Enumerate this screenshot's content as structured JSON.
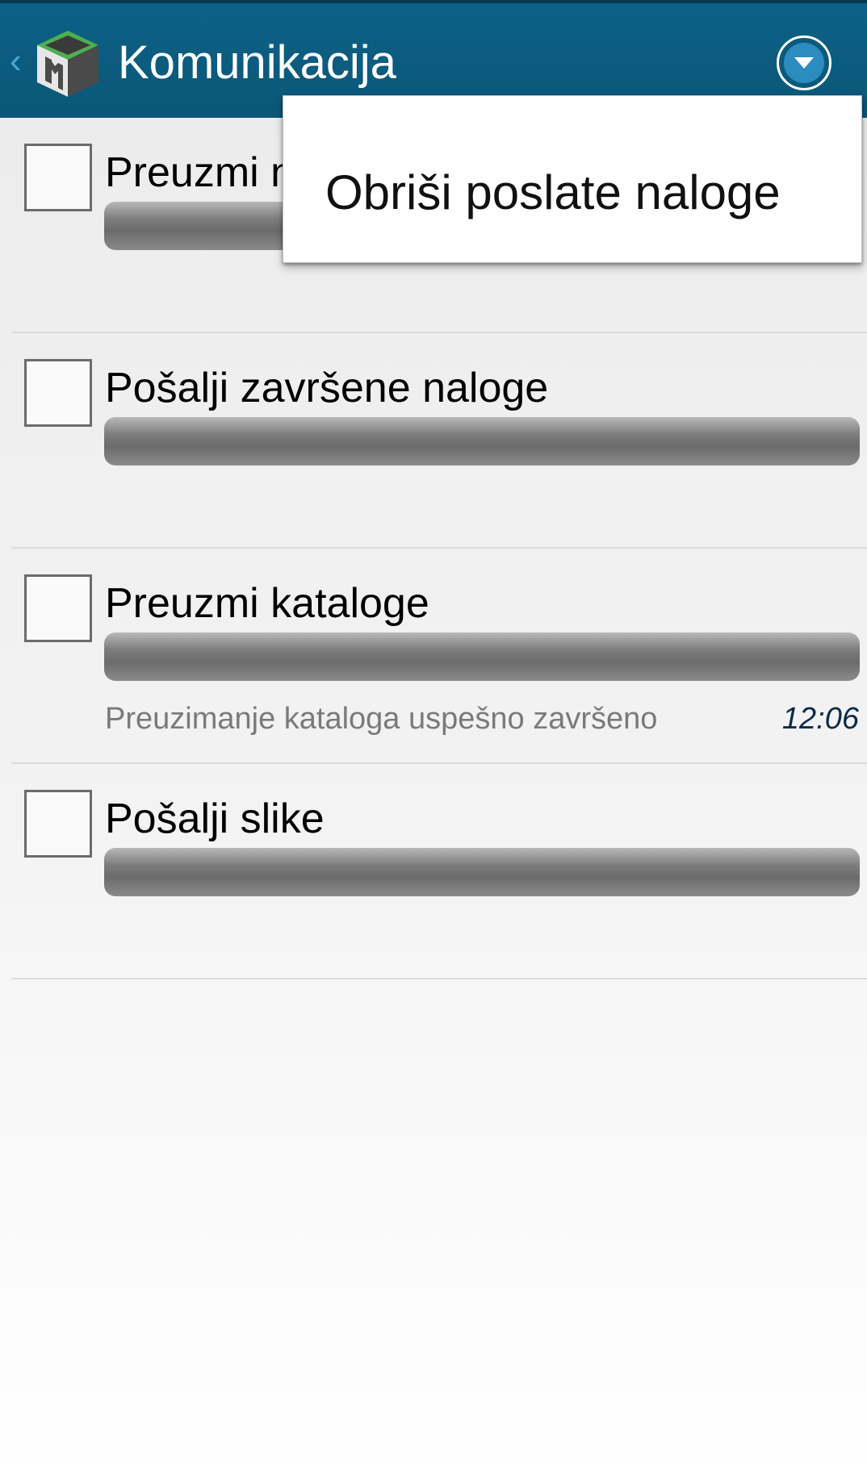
{
  "header": {
    "title": "Komunikacija",
    "back_icon": "chevron-left-icon",
    "logo_icon": "app-logo-icon",
    "menu_icon": "dropdown-circle-icon"
  },
  "popup_menu": {
    "items": [
      {
        "label": "Obriši poslate naloge"
      }
    ]
  },
  "tasks": [
    {
      "title": "Preuzmi ne",
      "checked": false,
      "progress": 0,
      "status": "",
      "time": ""
    },
    {
      "title": "Pošalji završene naloge",
      "checked": false,
      "progress": 0,
      "status": "",
      "time": ""
    },
    {
      "title": "Preuzmi kataloge",
      "checked": false,
      "progress": 0,
      "status": "Preuzimanje kataloga uspešno završeno",
      "time": "12:06"
    },
    {
      "title": "Pošalji slike",
      "checked": false,
      "progress": 0,
      "status": "",
      "time": ""
    }
  ],
  "colors": {
    "appbar": "#0b5a7c",
    "accent": "#2c8cc0",
    "time_text": "#0b2a4a"
  }
}
